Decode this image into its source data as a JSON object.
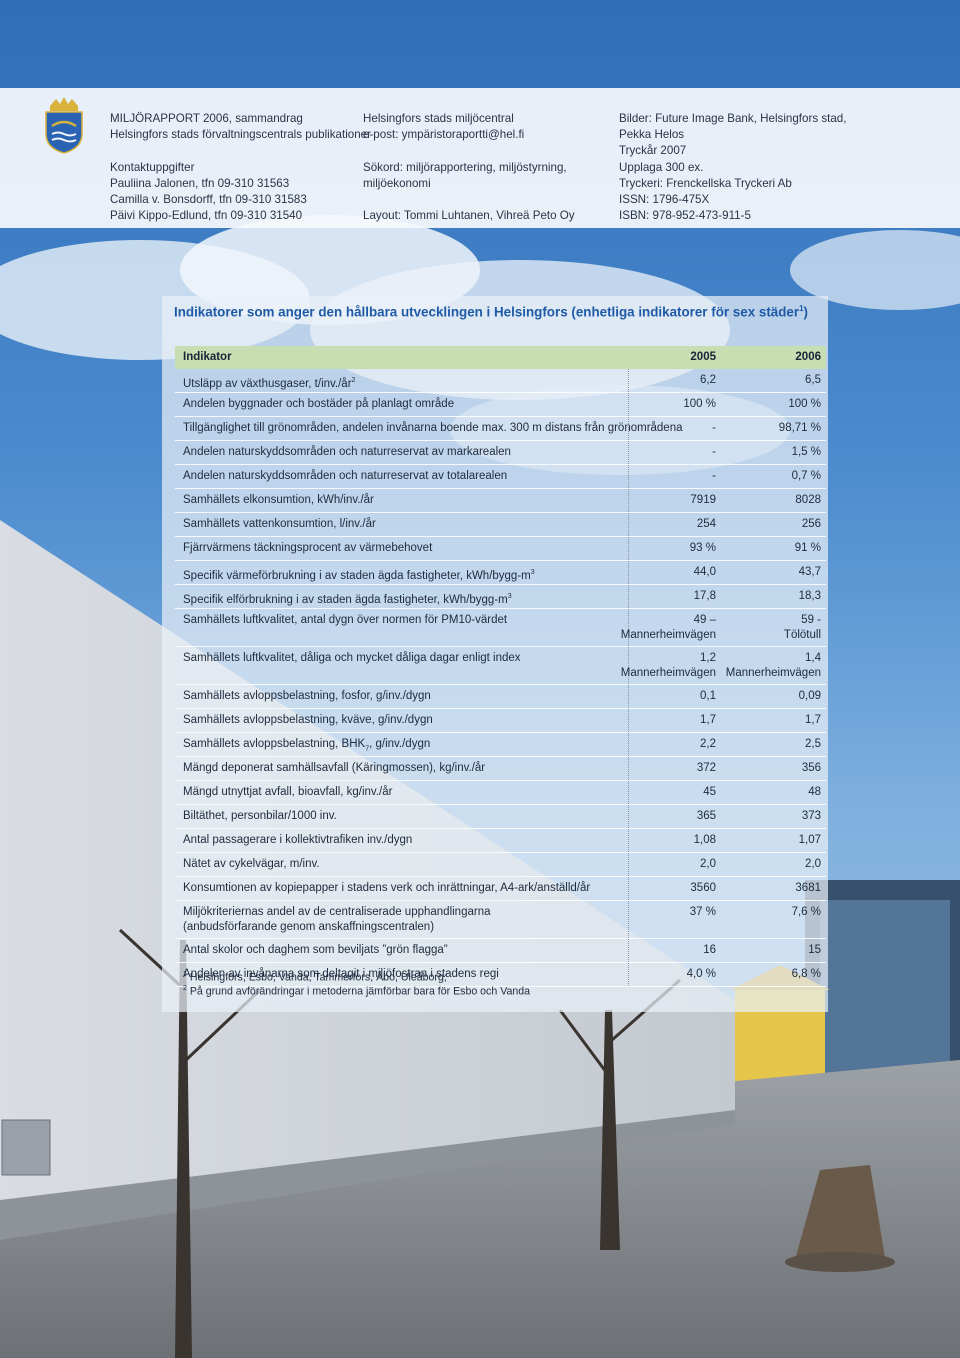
{
  "header": {
    "col1": [
      "MILJÖRAPPORT 2006, sammandrag",
      "Helsingfors stads förvaltningscentrals publikationer",
      "",
      "Kontaktuppgifter",
      "Pauliina Jalonen, tfn 09-310 31563",
      "Camilla v. Bonsdorff, tfn 09-310 31583",
      "Päivi Kippo-Edlund, tfn 09-310 31540"
    ],
    "col2": [
      "Helsingfors stads miljöcentral",
      "e-post: ympäristoraportti@hel.fi",
      "",
      "Sökord: miljörapportering, miljöstyrning,",
      "miljöekonomi",
      "",
      "Layout: Tommi Luhtanen, Vihreä Peto Oy"
    ],
    "col3": [
      "Bilder: Future Image Bank, Helsingfors stad,",
      "Pekka Helos",
      "Tryckår 2007",
      "Upplaga 300 ex.",
      "Tryckeri: Frenckellska Tryckeri Ab",
      "ISSN: 1796-475X",
      "ISBN: 978-952-473-911-5"
    ]
  },
  "table": {
    "title": "Indikatorer som anger den hållbara utvecklingen i Helsingfors (enhetliga indikatorer för sex städer",
    "title_sup": "1",
    "title_end": ")",
    "col_indicator": "Indikator",
    "col_2005": "2005",
    "col_2006": "2006",
    "rows": [
      {
        "label": "Utsläpp av växthusgaser, t/inv./år",
        "sup": "2",
        "v2005": "6,2",
        "v2006": "6,5"
      },
      {
        "label": "Andelen byggnader och bostäder på planlagt område",
        "v2005": "100 %",
        "v2006": "100 %"
      },
      {
        "label": "Tillgänglighet till grönområden, andelen invånarna boende max. 300 m distans från grönområdena",
        "v2005": "-",
        "v2006": "98,71 %"
      },
      {
        "label": "Andelen naturskyddsområden och naturreservat av markarealen",
        "v2005": "-",
        "v2006": "1,5 %"
      },
      {
        "label": "Andelen naturskyddsområden och naturreservat av totalarealen",
        "v2005": "-",
        "v2006": "0,7 %"
      },
      {
        "label": "Samhällets elkonsumtion, kWh/inv./år",
        "v2005": "7919",
        "v2006": "8028"
      },
      {
        "label": "Samhällets vattenkonsumtion, l/inv./år",
        "v2005": "254",
        "v2006": "256"
      },
      {
        "label": "Fjärrvärmens täckningsprocent av värmebehovet",
        "v2005": "93 %",
        "v2006": "91 %"
      },
      {
        "label": "Specifik värmeförbrukning i av staden ägda fastigheter, kWh/bygg-m",
        "sup": "3",
        "v2005": "44,0",
        "v2006": "43,7"
      },
      {
        "label": "Specifik elförbrukning i av staden ägda fastigheter, kWh/bygg-m",
        "sup": "3",
        "v2005": "17,8",
        "v2006": "18,3"
      },
      {
        "label": "Samhällets luftkvalitet, antal dygn över normen för PM10-värdet",
        "v2005": "49 –\nMannerheimvägen",
        "v2006": "59 -\nTölötull",
        "tall": true
      },
      {
        "label": "Samhällets luftkvalitet, dåliga och mycket dåliga dagar enligt index",
        "v2005": "1,2\nMannerheimvägen",
        "v2006": "1,4\nMannerheimvägen",
        "tall": true
      },
      {
        "label": "Samhällets avloppsbelastning, fosfor, g/inv./dygn",
        "v2005": "0,1",
        "v2006": "0,09"
      },
      {
        "label": "Samhällets avloppsbelastning, kväve, g/inv./dygn",
        "v2005": "1,7",
        "v2006": "1,7"
      },
      {
        "label": "Samhällets avloppsbelastning, BHK, g/inv./dygn",
        "sub": "7",
        "v2005": "2,2",
        "v2006": "2,5"
      },
      {
        "label": "Mängd deponerat samhällsavfall (Käringmossen), kg/inv./år",
        "v2005": "372",
        "v2006": "356"
      },
      {
        "label": "Mängd utnyttjat avfall, bioavfall, kg/inv./år",
        "v2005": "45",
        "v2006": "48"
      },
      {
        "label": "Biltäthet, personbilar/1000 inv.",
        "v2005": "365",
        "v2006": "373"
      },
      {
        "label": "Antal passagerare i kollektivtrafiken inv./dygn",
        "v2005": "1,08",
        "v2006": "1,07"
      },
      {
        "label": "Nätet av cykelvägar, m/inv.",
        "v2005": "2,0",
        "v2006": "2,0"
      },
      {
        "label": "Konsumtionen av kopiepapper i stadens verk och inrättningar, A4-ark/anställd/år",
        "v2005": "3560",
        "v2006": "3681"
      },
      {
        "label": "Miljökriteriernas andel av de centraliserade upphandlingarna\n(anbudsförfarande genom anskaffningscentralen)",
        "v2005": "37 %",
        "v2006": "7,6 %",
        "tall": true
      },
      {
        "label": "Antal skolor och daghem som beviljats ”grön flagga”",
        "v2005": "16",
        "v2006": "15"
      },
      {
        "label": "Andelen av invånarna som deltagit i miljöfostran i stadens regi",
        "v2005": "4,0 %",
        "v2006": "6,8 %"
      }
    ],
    "footnote1_num": "1",
    "footnote1": "Helsingfors, Esbo, Vanda, Tammerfors, Åbo, Uleåborg;",
    "footnote2_num": "2",
    "footnote2": "På grund avförändringar i metoderna jämförbar bara för Esbo och Vanda"
  },
  "colors": {
    "title_blue": "#1f5aa8",
    "header_green": "#c7ddb2",
    "crest_blue": "#2a63b4",
    "crest_gold": "#d8b23a"
  }
}
